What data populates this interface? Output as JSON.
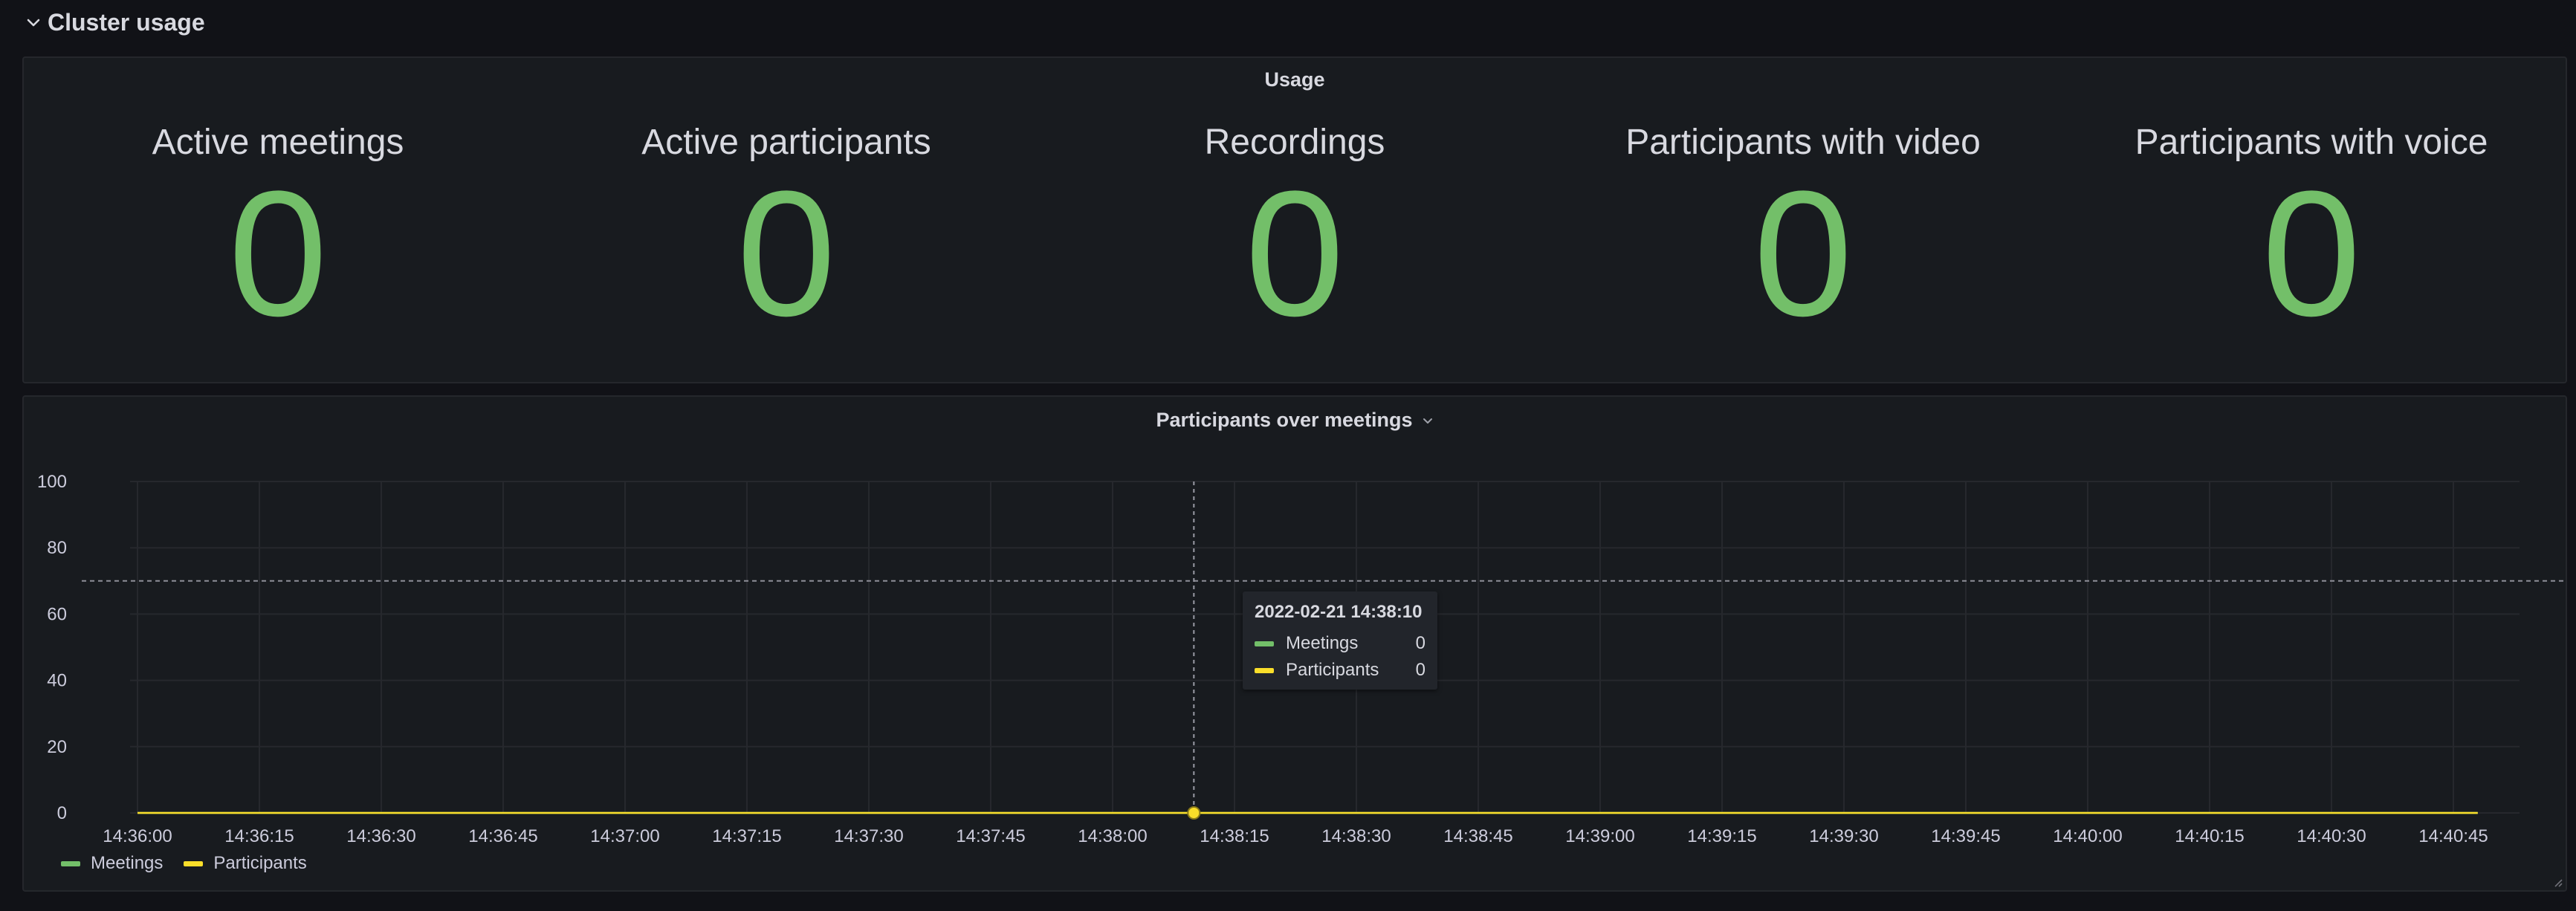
{
  "row": {
    "title": "Cluster usage"
  },
  "usage_panel": {
    "title": "Usage",
    "stats": [
      {
        "label": "Active meetings",
        "value": "0"
      },
      {
        "label": "Active participants",
        "value": "0"
      },
      {
        "label": "Recordings",
        "value": "0"
      },
      {
        "label": "Participants with video",
        "value": "0"
      },
      {
        "label": "Participants with voice",
        "value": "0"
      }
    ],
    "value_color": "#73bf69"
  },
  "chart_panel": {
    "title": "Participants over meetings",
    "tooltip": {
      "time": "2022-02-21 14:38:10",
      "rows": [
        {
          "name": "Meetings",
          "value": "0"
        },
        {
          "name": "Participants",
          "value": "0"
        }
      ]
    },
    "legend": [
      {
        "name": "Meetings"
      },
      {
        "name": "Participants"
      }
    ]
  },
  "chart_data": {
    "type": "line",
    "title": "Participants over meetings",
    "xlabel": "",
    "ylabel": "",
    "x_ticks": [
      "14:36:00",
      "14:36:15",
      "14:36:30",
      "14:36:45",
      "14:37:00",
      "14:37:15",
      "14:37:30",
      "14:37:45",
      "14:38:00",
      "14:38:15",
      "14:38:30",
      "14:38:45",
      "14:39:00",
      "14:39:15",
      "14:39:30",
      "14:39:45",
      "14:40:00",
      "14:40:15",
      "14:40:30",
      "14:40:45"
    ],
    "x_range": [
      "14:36:00",
      "14:40:48"
    ],
    "y_ticks": [
      "0",
      "20",
      "40",
      "60",
      "80",
      "100"
    ],
    "ylim": [
      0,
      100
    ],
    "threshold": 70,
    "hover_x": "14:38:10",
    "grid": true,
    "legend_position": "bottom-left",
    "series": [
      {
        "name": "Meetings",
        "color": "#73bf69",
        "x": [
          "14:36:00",
          "14:40:48"
        ],
        "values": [
          0,
          0
        ]
      },
      {
        "name": "Participants",
        "color": "#fade2a",
        "x": [
          "14:36:00",
          "14:40:48"
        ],
        "values": [
          0,
          0
        ]
      }
    ]
  }
}
